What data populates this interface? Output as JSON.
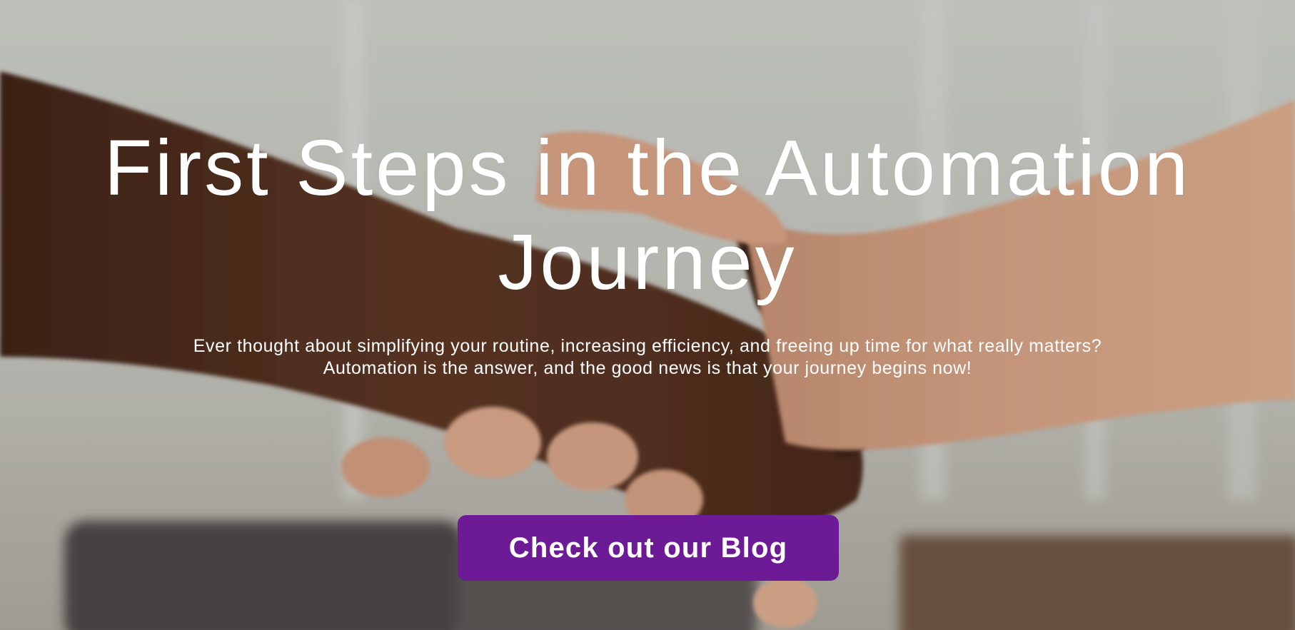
{
  "hero": {
    "title": "First Steps in the Automation Journey",
    "subtitle_line1": "Ever thought about simplifying your routine, increasing efficiency, and freeing up time for what really matters?",
    "subtitle_line2": "Automation is the answer, and the good news is that your journey begins now!",
    "cta_label": "Check out our Blog",
    "background_image": "handshake-photo"
  },
  "colors": {
    "cta_background": "#6d1a96",
    "text": "#ffffff"
  }
}
